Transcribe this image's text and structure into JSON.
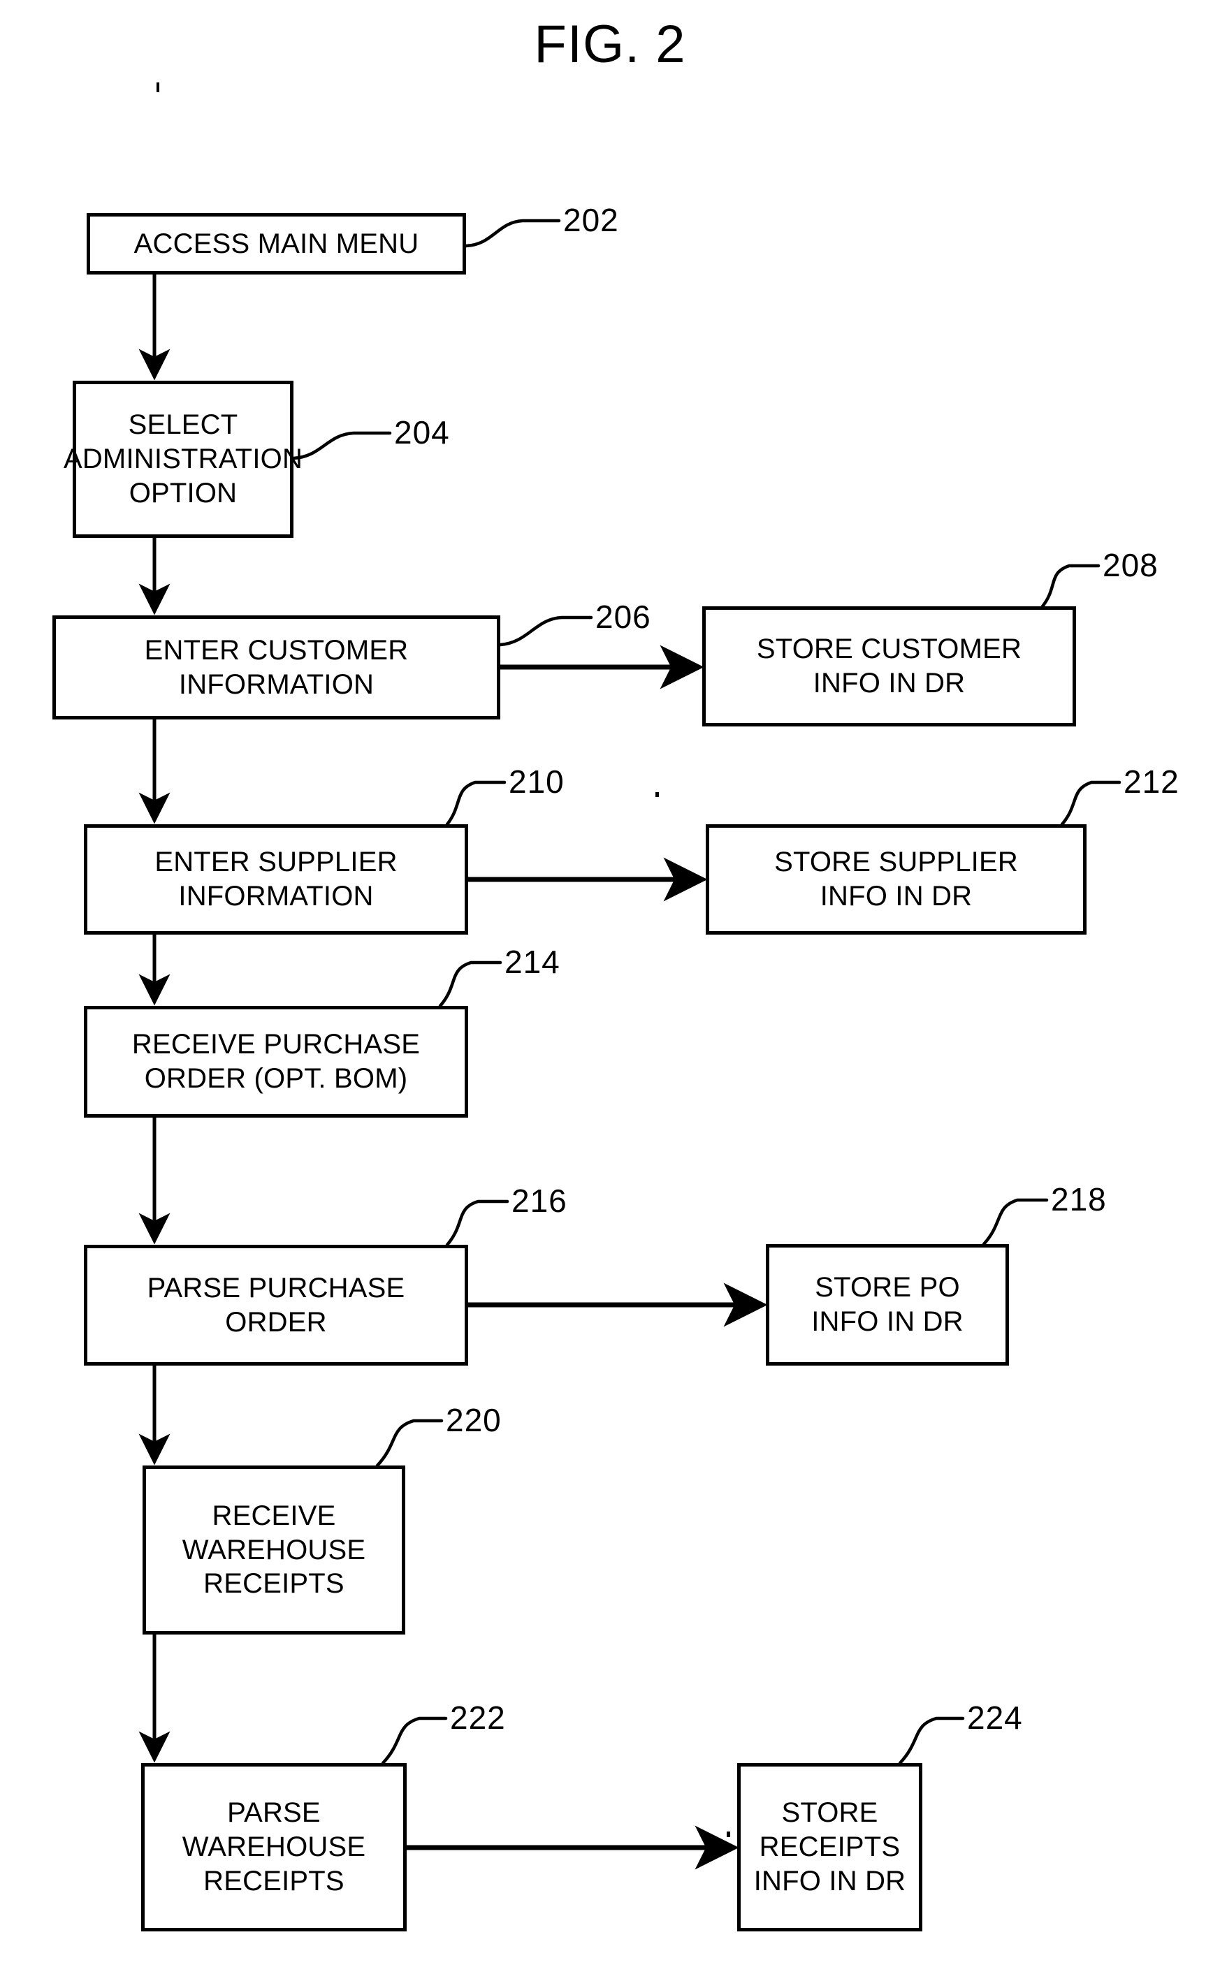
{
  "figure": {
    "title": "FIG. 2",
    "type": "patent-flowchart"
  },
  "nodes": [
    {
      "id": "202",
      "label": "ACCESS MAIN MENU"
    },
    {
      "id": "204",
      "label": "SELECT\nADMINISTRATION\nOPTION"
    },
    {
      "id": "206",
      "label": "ENTER CUSTOMER\nINFORMATION"
    },
    {
      "id": "208",
      "label": "STORE CUSTOMER\nINFO IN DR"
    },
    {
      "id": "210",
      "label": "ENTER SUPPLIER\nINFORMATION"
    },
    {
      "id": "212",
      "label": "STORE SUPPLIER\nINFO IN DR"
    },
    {
      "id": "214",
      "label": "RECEIVE PURCHASE\nORDER (OPT. BOM)"
    },
    {
      "id": "216",
      "label": "PARSE PURCHASE\nORDER"
    },
    {
      "id": "218",
      "label": "STORE PO\nINFO IN DR"
    },
    {
      "id": "220",
      "label": "RECEIVE\nWAREHOUSE\nRECEIPTS"
    },
    {
      "id": "222",
      "label": "PARSE\nWAREHOUSE\nRECEIPTS"
    },
    {
      "id": "224",
      "label": "STORE\nRECEIPTS\nINFO IN DR"
    }
  ],
  "reference_numerals": [
    {
      "id": "202",
      "text": "202"
    },
    {
      "id": "204",
      "text": "204"
    },
    {
      "id": "206",
      "text": "206"
    },
    {
      "id": "208",
      "text": "208"
    },
    {
      "id": "210",
      "text": "210"
    },
    {
      "id": "212",
      "text": "212"
    },
    {
      "id": "214",
      "text": "214"
    },
    {
      "id": "216",
      "text": "216"
    },
    {
      "id": "218",
      "text": "218"
    },
    {
      "id": "220",
      "text": "220"
    },
    {
      "id": "222",
      "text": "222"
    },
    {
      "id": "224",
      "text": "224"
    }
  ],
  "flow": {
    "vertical_sequence": [
      "202",
      "204",
      "206",
      "210",
      "214",
      "216",
      "220",
      "222"
    ],
    "branches": [
      {
        "from": "206",
        "to": "208"
      },
      {
        "from": "210",
        "to": "212"
      },
      {
        "from": "216",
        "to": "218"
      },
      {
        "from": "222",
        "to": "224"
      }
    ]
  },
  "colors": {
    "ink": "#000000",
    "paper": "#ffffff"
  }
}
